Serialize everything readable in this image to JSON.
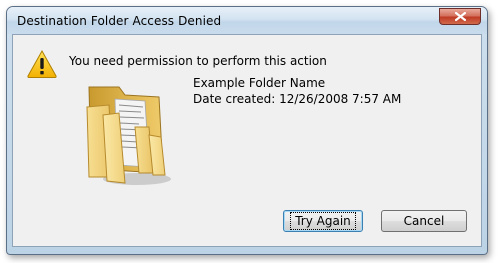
{
  "window": {
    "title": "Destination Folder Access Denied",
    "close_icon": "close-icon"
  },
  "message": {
    "icon": "warning-icon",
    "heading": "You need permission to perform this action"
  },
  "item": {
    "icon": "folder-icon",
    "name": "Example Folder Name",
    "date_created": "Date created: 12/26/2008 7:57 AM"
  },
  "buttons": {
    "try_again": "Try Again",
    "cancel": "Cancel"
  },
  "colors": {
    "title_bar": "#d3e3f1",
    "close_button": "#c94a32",
    "client_bg": "#f0f0f0",
    "default_button_border": "#3c7fb1"
  }
}
